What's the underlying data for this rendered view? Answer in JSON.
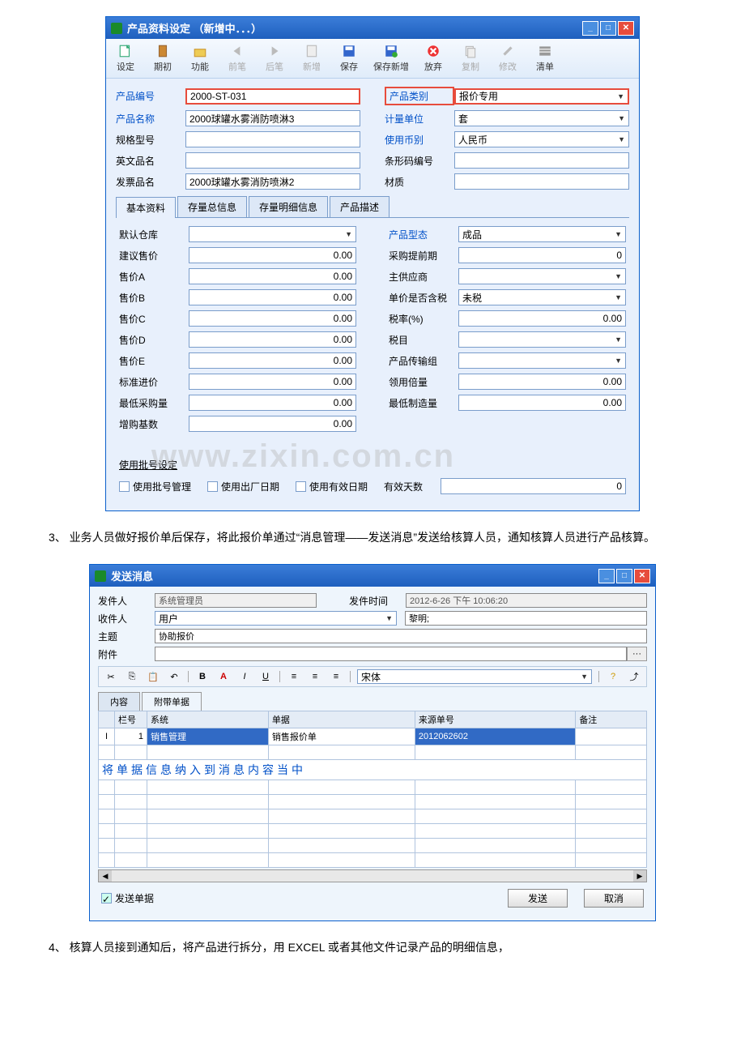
{
  "window1": {
    "title": "产品资料设定 （新增中．．．）",
    "toolbar": {
      "setting": "设定",
      "qichu": "期初",
      "func": "功能",
      "prev": "前笔",
      "next": "后笔",
      "new": "新增",
      "save": "保存",
      "saveNew": "保存新增",
      "abandon": "放弃",
      "copy": "复制",
      "modify": "修改",
      "list": "清单"
    },
    "fields": {
      "productCode_lbl": "产品编号",
      "productCode": "2000-ST-031",
      "productName_lbl": "产品名称",
      "productName": "2000球罐水雾消防喷淋3",
      "spec_lbl": "规格型号",
      "spec": "",
      "engName_lbl": "英文品名",
      "engName": "",
      "invoiceName_lbl": "发票品名",
      "invoiceName": "2000球罐水雾消防喷淋2",
      "category_lbl": "产品类别",
      "category": "报价专用",
      "unit_lbl": "计量单位",
      "unit": "套",
      "currency_lbl": "使用币别",
      "currency": "人民币",
      "barcode_lbl": "条形码编号",
      "barcode": "",
      "material_lbl": "材质",
      "material": ""
    },
    "tabs": {
      "t1": "基本资料",
      "t2": "存量总信息",
      "t3": "存量明细信息",
      "t4": "产品描述"
    },
    "left": {
      "defaultWarehouse_lbl": "默认仓库",
      "defaultWarehouse": "",
      "suggestPrice_lbl": "建议售价",
      "suggestPrice": "0.00",
      "priceA_lbl": "售价A",
      "priceA": "0.00",
      "priceB_lbl": "售价B",
      "priceB": "0.00",
      "priceC_lbl": "售价C",
      "priceC": "0.00",
      "priceD_lbl": "售价D",
      "priceD": "0.00",
      "priceE_lbl": "售价E",
      "priceE": "0.00",
      "stdPurchase_lbl": "标准进价",
      "stdPurchase": "0.00",
      "minPurchase_lbl": "最低采购量",
      "minPurchase": "0.00",
      "addBase_lbl": "增购基数",
      "addBase": "0.00"
    },
    "right": {
      "productType_lbl": "产品型态",
      "productType": "成品",
      "leadTime_lbl": "采购提前期",
      "leadTime": "0",
      "mainSupplier_lbl": "主供应商",
      "mainSupplier": "",
      "taxIncluded_lbl": "单价是否含税",
      "taxIncluded": "未税",
      "taxRate_lbl": "税率(%)",
      "taxRate": "0.00",
      "taxItem_lbl": "税目",
      "taxItem": "",
      "transGroup_lbl": "产品传输组",
      "transGroup": "",
      "multiplier_lbl": "领用倍量",
      "multiplier": "0.00",
      "minMfg_lbl": "最低制造量",
      "minMfg": "0.00"
    },
    "batch": {
      "title": "使用批号设定",
      "c1": "使用批号管理",
      "c2": "使用出厂日期",
      "c3": "使用有效日期",
      "validDays_lbl": "有效天数",
      "validDays": "0"
    },
    "watermark": "www.zixin.com.cn"
  },
  "instr3": "3、 业务人员做好报价单后保存，将此报价单通过“消息管理——发送消息”发送给核算人员，通知核算人员进行产品核算。",
  "window2": {
    "title": "发送消息",
    "sender_lbl": "发件人",
    "sender": "系统管理员",
    "sendTime_lbl": "发件时间",
    "sendTime": "2012-6-26 下午 10:06:20",
    "recipient_lbl": "收件人",
    "recipient": "用户",
    "liming": "黎明;",
    "subject_lbl": "主题",
    "subject": "协助报价",
    "attach_lbl": "附件",
    "attach_btn": "···",
    "font": "宋体",
    "tabs": {
      "content": "内容",
      "docs": "附带单据"
    },
    "gridHeaders": {
      "h1": "栏号",
      "h2": "系统",
      "h3": "单据",
      "h4": "来源单号",
      "h5": "备注"
    },
    "gridRow": {
      "c1": "1",
      "c2": "销售管理",
      "c3": "销售报价单",
      "c4": "2012062602",
      "c5": ""
    },
    "gridNote": "将单据信息纳入到消息内容当中",
    "chkSend": "发送单据",
    "btnSend": "发送",
    "btnCancel": "取消",
    "rowMarker": "I"
  },
  "instr4": "4、 核算人员接到通知后，将产品进行拆分，用 EXCEL 或者其他文件记录产品的明细信息，"
}
